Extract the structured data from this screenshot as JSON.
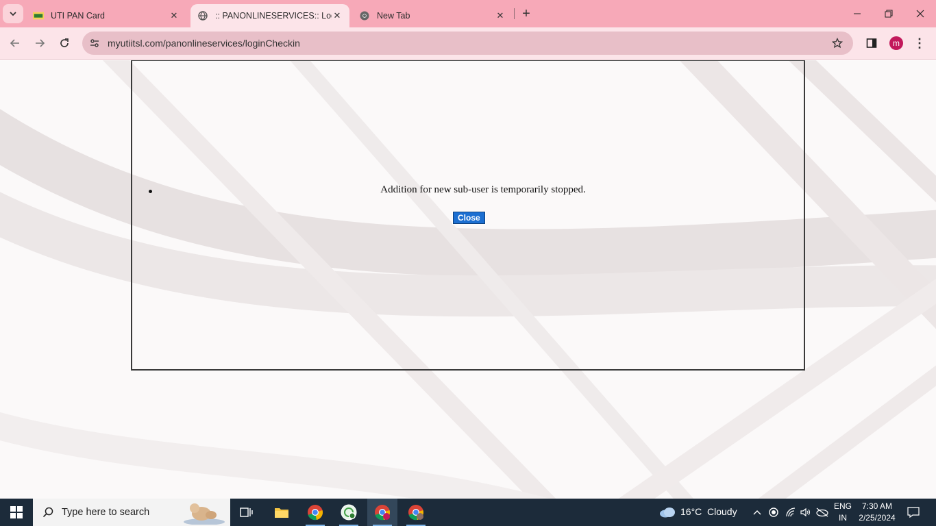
{
  "browser": {
    "tabs": [
      {
        "title": "UTI PAN Card",
        "active": false
      },
      {
        "title": ":: PANONLINESERVICES:: Logge",
        "active": true
      },
      {
        "title": "New Tab",
        "active": false
      }
    ],
    "url": "myutiitsl.com/panonlineservices/loginCheckin",
    "profile_initial": "m",
    "accent_color": "#f7a9b8"
  },
  "page": {
    "message": "Addition for new sub-user is temporarily stopped.",
    "close_button_label": "Close",
    "button_color": "#1c6fd1"
  },
  "taskbar": {
    "search_placeholder": "Type here to search",
    "weather": {
      "temperature": "16°C",
      "condition": "Cloudy"
    },
    "language": {
      "line1": "ENG",
      "line2": "IN"
    },
    "clock": {
      "time": "7:30 AM",
      "date": "2/25/2024"
    },
    "apps": [
      "task-view-icon",
      "file-explorer-icon",
      "chrome-icon",
      "chrome-profile-icon",
      "chrome-icon",
      "chrome-icon"
    ]
  }
}
